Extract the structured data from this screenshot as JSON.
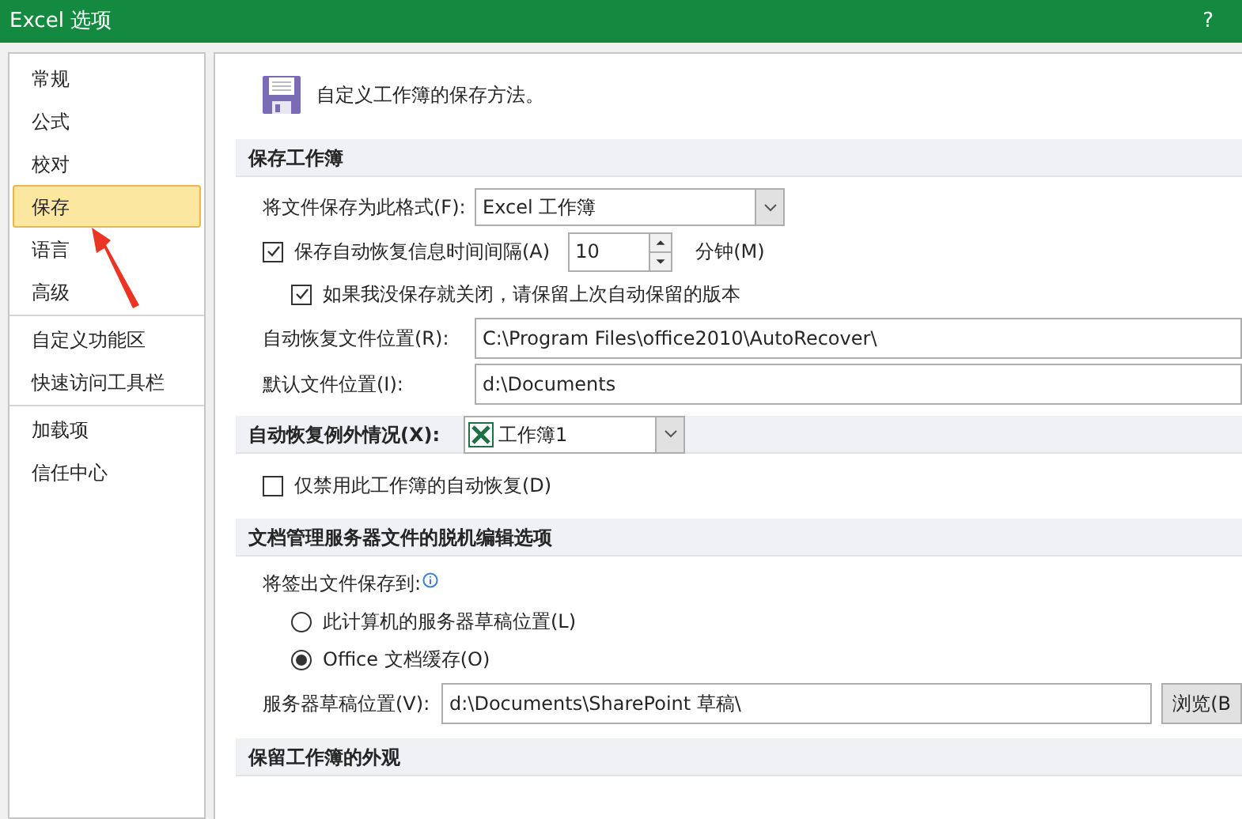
{
  "window": {
    "title": "Excel 选项",
    "help": "?"
  },
  "sidebar": {
    "groups": [
      {
        "items": [
          {
            "label": "常规",
            "selected": false
          },
          {
            "label": "公式",
            "selected": false
          },
          {
            "label": "校对",
            "selected": false
          },
          {
            "label": "保存",
            "selected": true
          },
          {
            "label": "语言",
            "selected": false
          },
          {
            "label": "高级",
            "selected": false
          }
        ]
      },
      {
        "items": [
          {
            "label": "自定义功能区",
            "selected": false
          },
          {
            "label": "快速访问工具栏",
            "selected": false
          }
        ]
      },
      {
        "items": [
          {
            "label": "加载项",
            "selected": false
          },
          {
            "label": "信任中心",
            "selected": false
          }
        ]
      }
    ]
  },
  "page_header": "自定义工作簿的保存方法。",
  "sections": [
    {
      "heading": "保存工作簿",
      "rows": [
        {
          "kind": "select",
          "label": "将文件保存为此格式(F):",
          "value": "Excel 工作簿"
        },
        {
          "kind": "spin",
          "label": "保存自动恢复信息时间间隔(A)",
          "checked": true,
          "value": "10",
          "unit": "分钟(M)",
          "children": [
            {
              "kind": "checkbox",
              "label": "如果我没保存就关闭，请保留上次自动保留的版本",
              "checked": true
            }
          ]
        },
        {
          "kind": "path",
          "label": "自动恢复文件位置(R):",
          "value": "C:\\Program Files\\office2010\\AutoRecover\\"
        },
        {
          "kind": "path",
          "label": "默认文件位置(I):",
          "value": "d:\\Documents"
        }
      ]
    },
    {
      "heading": "自动恢复例外情况(X):",
      "heading_select": "工作簿1",
      "rows": [
        {
          "kind": "checkbox",
          "label": "仅禁用此工作簿的自动恢复(D)",
          "checked": false
        }
      ]
    },
    {
      "heading": "文档管理服务器文件的脱机编辑选项",
      "rows": [
        {
          "kind": "info_label",
          "label": "将签出文件保存到:"
        },
        {
          "kind": "radio",
          "label": "此计算机的服务器草稿位置(L)",
          "selected": false
        },
        {
          "kind": "radio",
          "label": "Office 文档缓存(O)",
          "selected": true
        },
        {
          "kind": "path_browse",
          "label": "服务器草稿位置(V):",
          "value": "d:\\Documents\\SharePoint 草稿\\",
          "button": "浏览(B"
        }
      ]
    },
    {
      "heading": "保留工作簿的外观"
    }
  ]
}
